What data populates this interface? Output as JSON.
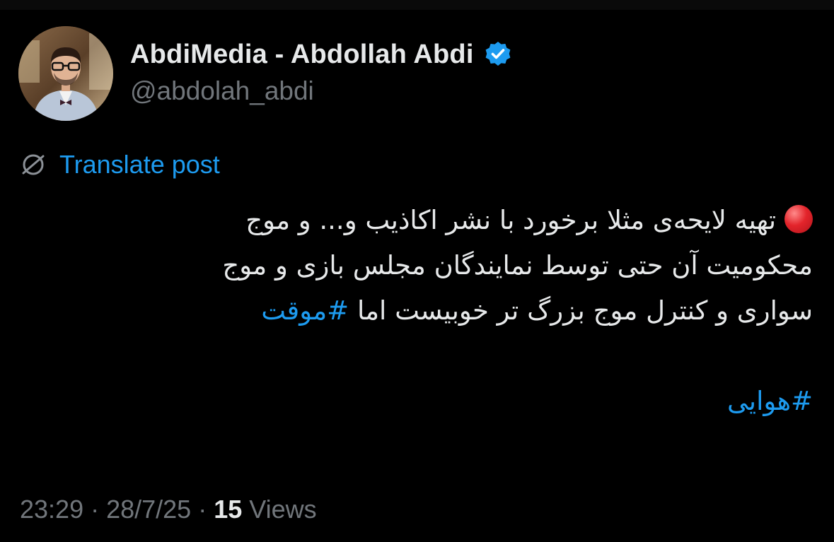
{
  "author": {
    "display_name": "AbdiMedia - Abdollah Abdi",
    "handle": "@abdolah_abdi",
    "verified": true,
    "avatar_icon": "profile-photo"
  },
  "translate": {
    "icon": "globe-slash-icon",
    "label": "Translate post"
  },
  "post": {
    "line1": "تهیه لایحه‌ی مثلا برخورد با نشر اکاذیب و... و موج",
    "line2": "محکومیت آن حتی توسط نمایندگان مجلس بازی و موج",
    "line3_text": "سواری و کنترل موج بزرگ تر خوبیست اما ",
    "hashtag1": "#موقت",
    "hashtag2": "#هوایی"
  },
  "meta": {
    "time": "23:29",
    "date": "28/7/25",
    "separator": "·",
    "views_count": "15",
    "views_label": "Views"
  },
  "colors": {
    "background": "#000000",
    "text": "#e7e9ea",
    "secondary": "#71767b",
    "link": "#1d9bf0",
    "verified": "#1d9bf0"
  }
}
